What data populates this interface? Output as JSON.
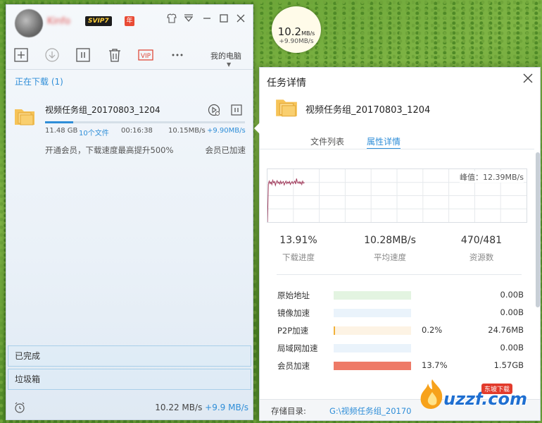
{
  "main": {
    "svip": "SVIP7",
    "year_badge": "年",
    "my_pc": "我的电脑",
    "section_downloading": "正在下载 (1)",
    "task": {
      "name": "视频任务组_20170803_1204",
      "progress": 0.14,
      "size": "11.48 GB",
      "files": "10个文件",
      "time": "00:16:38",
      "speed": "10.15MB/s",
      "boost": "+9.90MB/s",
      "promo": "开通会员，下载速度最高提升500%",
      "vip_status": "会员已加速"
    },
    "nav_completed": "已完成",
    "nav_trash": "垃圾箱",
    "footer_speed": "10.22 MB/s",
    "footer_boost": "+9.9 MB/s"
  },
  "bubble": {
    "speed": "10.2",
    "unit": "MB/s",
    "boost": "+9.90MB/s"
  },
  "details": {
    "title": "任务详情",
    "task_name": "视频任务组_20170803_1204",
    "tabs": [
      "文件列表",
      "属性详情"
    ],
    "active_tab": 1,
    "peak": "峰值：12.39MB/s",
    "stats": [
      {
        "value": "13.91%",
        "label": "下载进度"
      },
      {
        "value": "10.28MB/s",
        "label": "平均速度"
      },
      {
        "value": "470/481",
        "label": "资源数"
      }
    ],
    "sources": [
      {
        "name": "原始地址",
        "pct": "",
        "size": "0.00B",
        "color": "#e3f4e1",
        "fill": 0,
        "fill_color": "#7fd26b"
      },
      {
        "name": "镜像加速",
        "pct": "",
        "size": "0.00B",
        "color": "#eaf3fb",
        "fill": 0,
        "fill_color": "#5aa9e6"
      },
      {
        "name": "P2P加速",
        "pct": "0.2%",
        "size": "24.76MB",
        "color": "#fdf3e4",
        "fill": 0.02,
        "fill_color": "#f2b13a"
      },
      {
        "name": "局域网加速",
        "pct": "",
        "size": "0.00B",
        "color": "#eaf3fb",
        "fill": 0,
        "fill_color": "#5aa9e6"
      },
      {
        "name": "会员加速",
        "pct": "13.7%",
        "size": "1.57GB",
        "color": "#f4f4f4",
        "fill": 1.0,
        "fill_color": "#ee7a67"
      }
    ],
    "storage_label": "存储目录:",
    "storage_path": "G:\\视频任务组_20170"
  },
  "watermark": {
    "text": "uzzf.com",
    "tag": "东坡下载"
  },
  "speed_graph": {
    "points": [
      0,
      8.9,
      9.6,
      9.0,
      9.4,
      8.8,
      9.8,
      9.2,
      9.5,
      8.6,
      9.3,
      9.7,
      9.1,
      9.4,
      8.9,
      9.6,
      9.0,
      9.3,
      9.5,
      8.7,
      9.2,
      9.6,
      9.0,
      9.4,
      9.1,
      9.5,
      8.8,
      9.2,
      9.5,
      9.0,
      9.3,
      9.6,
      8.9,
      10.2,
      9.3,
      9.1,
      9.5,
      9.0,
      9.4,
      8.8,
      9.6,
      9.1,
      9.3
    ],
    "max": 12.39
  }
}
